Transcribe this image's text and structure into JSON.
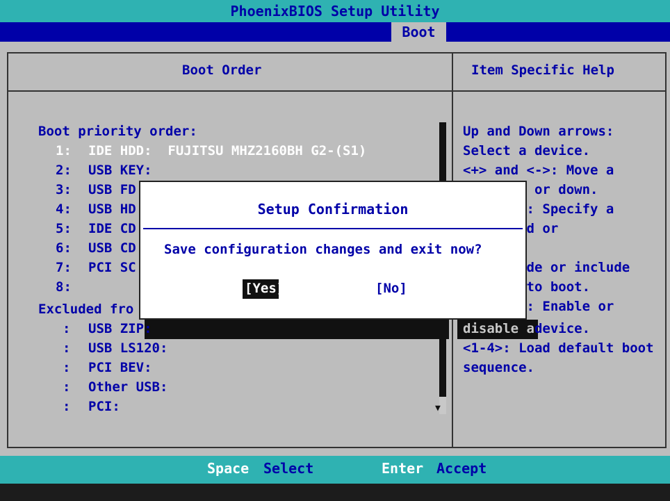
{
  "title": "PhoenixBIOS Setup Utility",
  "menu": {
    "active_tab": "Boot"
  },
  "panels": {
    "left_header": "Boot Order",
    "right_header": "Item Specific Help"
  },
  "boot_order": {
    "heading": "Boot priority order:",
    "items": [
      {
        "num": "1:",
        "name": "IDE HDD:  FUJITSU MHZ2160BH G2-(S1)"
      },
      {
        "num": "2:",
        "name": "USB KEY:"
      },
      {
        "num": "3:",
        "name": "USB FD"
      },
      {
        "num": "4:",
        "name": "USB HD"
      },
      {
        "num": "5:",
        "name": "IDE CD"
      },
      {
        "num": "6:",
        "name": "USB CD"
      },
      {
        "num": "7:",
        "name": "PCI SC"
      },
      {
        "num": "8:",
        "name": ""
      }
    ],
    "excluded_heading": "Excluded fro",
    "excluded": [
      {
        "num": ":",
        "name": "USB ZIP:"
      },
      {
        "num": ":",
        "name": "USB LS120:"
      },
      {
        "num": ":",
        "name": "PCI BEV:"
      },
      {
        "num": ":",
        "name": "Other USB:"
      },
      {
        "num": ":",
        "name": "PCI:"
      }
    ]
  },
  "help_lines": [
    "Up and Down arrows:",
    "Select a device.",
    "<+> and <->: Move a",
    "       p or down.",
    "      r>: Specify a",
    "      xed or",
    "      .",
    "      lude or include",
    "      e to boot.",
    "      1>: Enable or",
    "         device.",
    "<1-4>: Load default boot",
    "sequence."
  ],
  "help_highlight": "disable a",
  "dialog": {
    "title": "Setup Confirmation",
    "message": "Save configuration changes and exit now?",
    "yes": "[Yes]",
    "no": "[No]"
  },
  "footer": {
    "key1": "Space",
    "label1": "Select",
    "key2": "Enter",
    "label2": "Accept"
  },
  "colors": {
    "teal": "#2fb2b2",
    "blue": "#0000a8",
    "grey": "#bdbdbd"
  }
}
